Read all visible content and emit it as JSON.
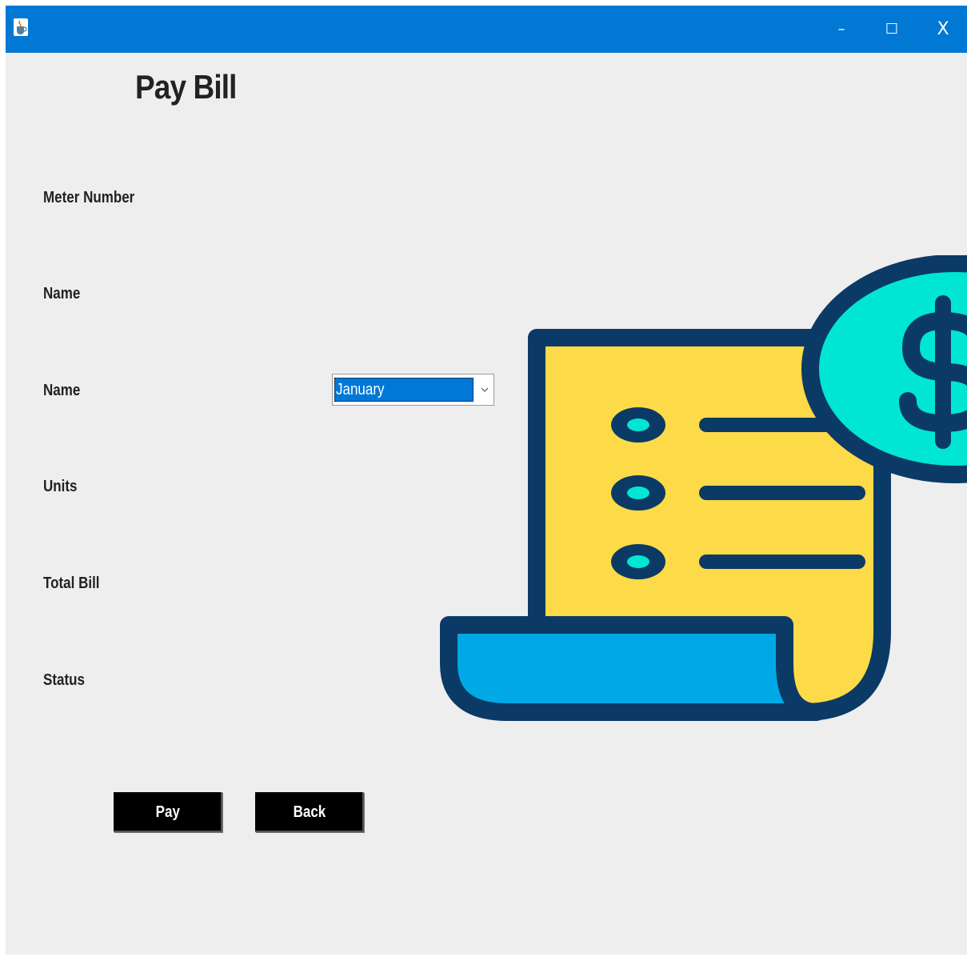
{
  "window": {
    "title_icon": "java-coffee-icon",
    "controls": {
      "minimize": "–",
      "maximize": "☐",
      "close": "X"
    },
    "accent_color": "#0078d4"
  },
  "page": {
    "title": "Pay Bill"
  },
  "form": {
    "meter_number_label": "Meter Number",
    "name_label": "Name",
    "month_label": "Name",
    "month_value": "January",
    "units_label": "Units",
    "total_bill_label": "Total Bill",
    "status_label": "Status"
  },
  "buttons": {
    "pay": "Pay",
    "back": "Back"
  },
  "illustration": {
    "icon": "bill-invoice-dollar-icon",
    "colors": {
      "outline": "#0b3a66",
      "paper": "#fdda47",
      "coin": "#00e6d2",
      "scroll": "#00a9e6"
    }
  }
}
